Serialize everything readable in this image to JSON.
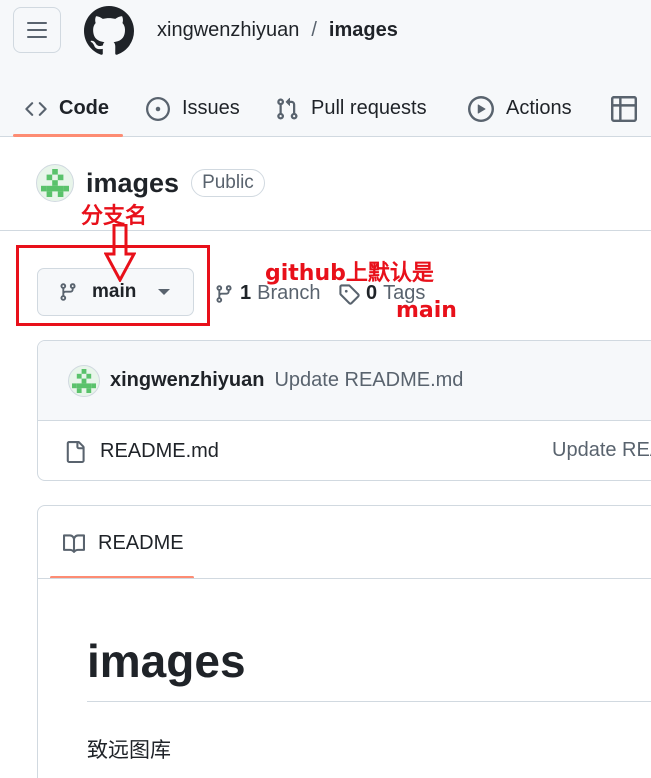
{
  "header": {
    "owner": "xingwenzhiyuan",
    "separator": "/",
    "repo": "images"
  },
  "tabs": [
    {
      "label": "Code",
      "icon": "code-icon"
    },
    {
      "label": "Issues",
      "icon": "issue-icon"
    },
    {
      "label": "Pull requests",
      "icon": "pull-request-icon"
    },
    {
      "label": "Actions",
      "icon": "play-icon"
    },
    {
      "label": "",
      "icon": "table-icon"
    }
  ],
  "repo": {
    "name": "images",
    "visibility": "Public"
  },
  "branch": {
    "current": "main",
    "branch_count": "1",
    "branch_label": "Branch",
    "tag_count": "0",
    "tag_label": "Tags"
  },
  "annotations": {
    "label_branch_name": "分支名",
    "label_default_1": "github上默认是",
    "label_default_2": "main",
    "color": "#e8101a"
  },
  "latest_commit": {
    "author": "xingwenzhiyuan",
    "message": "Update README.md"
  },
  "files": [
    {
      "name": "README.md",
      "commit": "Update README.md"
    }
  ],
  "readme": {
    "tab_label": "README",
    "heading": "images",
    "paragraph": "致远图库"
  },
  "colors": {
    "accent_underline": "#fd8c73",
    "muted_text": "#59636e",
    "border": "#d1d9e0"
  }
}
